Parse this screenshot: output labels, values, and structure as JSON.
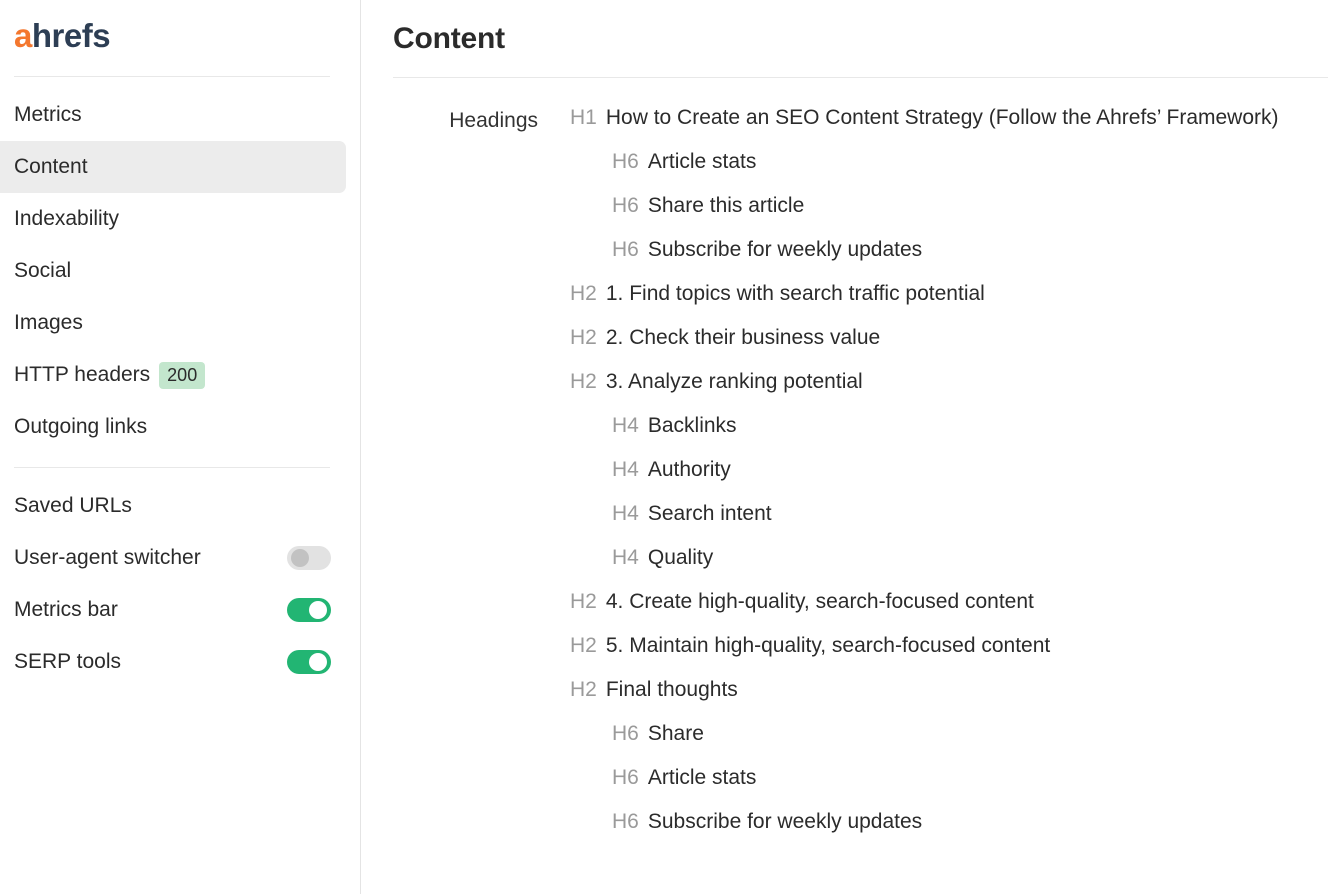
{
  "brand": {
    "accent_letter": "a",
    "rest": "hrefs",
    "accent_color": "#f4772e",
    "text_color": "#2d3e54"
  },
  "sidebar": {
    "nav_items": [
      {
        "label": "Metrics",
        "active": false,
        "badge": null
      },
      {
        "label": "Content",
        "active": true,
        "badge": null
      },
      {
        "label": "Indexability",
        "active": false,
        "badge": null
      },
      {
        "label": "Social",
        "active": false,
        "badge": null
      },
      {
        "label": "Images",
        "active": false,
        "badge": null
      },
      {
        "label": "HTTP headers",
        "active": false,
        "badge": "200"
      },
      {
        "label": "Outgoing links",
        "active": false,
        "badge": null
      }
    ],
    "settings_items": [
      {
        "label": "Saved URLs",
        "toggle": null
      },
      {
        "label": "User-agent switcher",
        "toggle": "off"
      },
      {
        "label": "Metrics bar",
        "toggle": "on"
      },
      {
        "label": "SERP tools",
        "toggle": "on"
      }
    ],
    "badge_bg": "#c3e6cd",
    "toggle_on_color": "#22b573",
    "toggle_off_color": "#e2e2e2",
    "active_bg": "#ececec"
  },
  "main": {
    "title": "Content",
    "section_label": "Headings",
    "headings": [
      {
        "tag": "H1",
        "level": 1,
        "text": "How to Create an SEO Content Strategy (Follow the Ahrefs’ Framework)"
      },
      {
        "tag": "H6",
        "level": 6,
        "text": "Article stats"
      },
      {
        "tag": "H6",
        "level": 6,
        "text": "Share this article"
      },
      {
        "tag": "H6",
        "level": 6,
        "text": "Subscribe for weekly updates"
      },
      {
        "tag": "H2",
        "level": 2,
        "text": "1. Find topics with search traffic potential"
      },
      {
        "tag": "H2",
        "level": 2,
        "text": "2. Check their business value"
      },
      {
        "tag": "H2",
        "level": 2,
        "text": "3. Analyze ranking potential"
      },
      {
        "tag": "H4",
        "level": 4,
        "text": "Backlinks"
      },
      {
        "tag": "H4",
        "level": 4,
        "text": "Authority"
      },
      {
        "tag": "H4",
        "level": 4,
        "text": "Search intent"
      },
      {
        "tag": "H4",
        "level": 4,
        "text": "Quality"
      },
      {
        "tag": "H2",
        "level": 2,
        "text": "4. Create high-quality, search-focused content"
      },
      {
        "tag": "H2",
        "level": 2,
        "text": "5. Maintain high-quality, search-focused content"
      },
      {
        "tag": "H2",
        "level": 2,
        "text": "Final thoughts"
      },
      {
        "tag": "H6",
        "level": 6,
        "text": "Share"
      },
      {
        "tag": "H6",
        "level": 6,
        "text": "Article stats"
      },
      {
        "tag": "H6",
        "level": 6,
        "text": "Subscribe for weekly updates"
      }
    ]
  }
}
